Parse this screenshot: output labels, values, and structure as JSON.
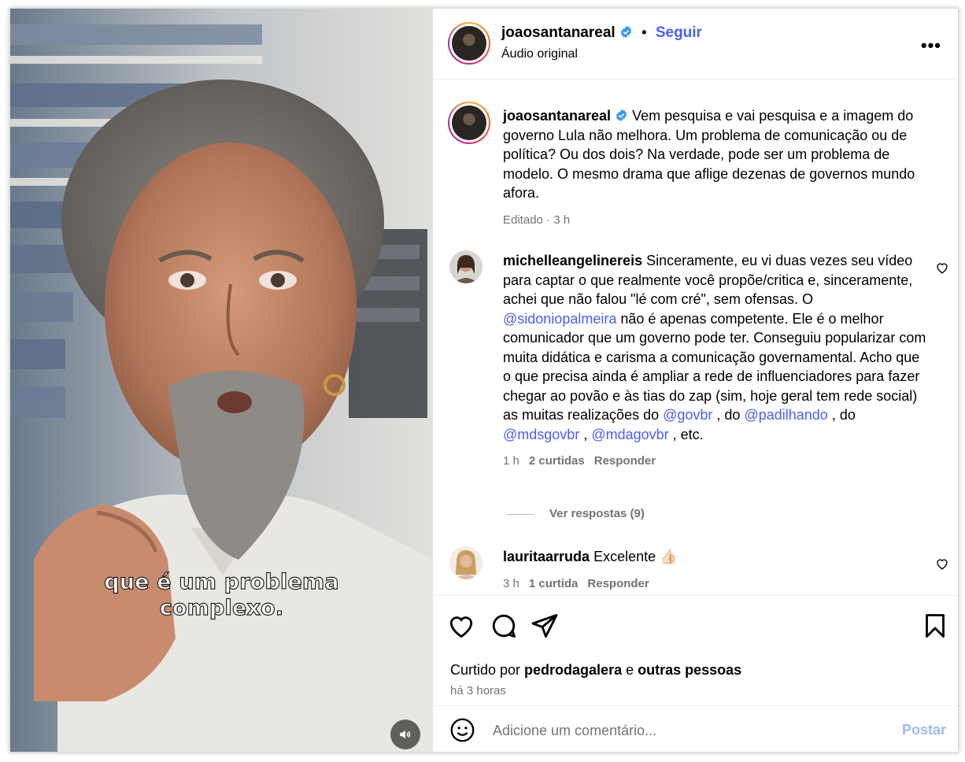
{
  "video": {
    "caption_line1": "que é um problema",
    "caption_line2": "complexo.",
    "mute_icon": "speaker-icon"
  },
  "header": {
    "username": "joaosantanareal",
    "separator": "•",
    "follow_label": "Seguir",
    "subtitle": "Áudio original",
    "more_icon": "more-horizontal-icon"
  },
  "post": {
    "author": "joaosantanareal",
    "text": "Vem pesquisa e vai pesquisa e a imagem do governo Lula não melhora. Um problema de comunicação ou de política? Ou dos dois? Na verdade, pode ser um problema de modelo. O mesmo drama que aflige dezenas de governos mundo afora.",
    "meta": "Editado · 3 h"
  },
  "comments": [
    {
      "author": "michelleangelinereis",
      "text_1": "Sinceramente, eu vi duas vezes seu vídeo para captar o que realmente você propõe/critica e, sinceramente, achei que não falou \"lé com cré\", sem ofensas. O ",
      "mention_1": "@sidoniopalmeira",
      "text_2": " não é apenas competente. Ele é o melhor comunicador que um governo pode ter. Conseguiu popularizar com muita didática e carisma a comunicação governamental. Acho que o que precisa ainda é ampliar a rede de influenciadores para fazer chegar ao povão e às tias do zap (sim, hoje geral tem rede social) as muitas realizações do ",
      "mention_2": "@govbr",
      "text_3": " , do ",
      "mention_3": "@padilhando",
      "text_4": " , do ",
      "mention_4": "@mdsgovbr",
      "text_5": " , ",
      "mention_5": "@mdagovbr",
      "text_6": " , etc.",
      "time": "1 h",
      "likes": "2 curtidas",
      "reply": "Responder",
      "view_replies": "Ver respostas (9)"
    },
    {
      "author": "lauritaarruda",
      "text": "Excelente 👍🏻",
      "time": "3 h",
      "likes": "1 curtida",
      "reply": "Responder"
    }
  ],
  "actions": {
    "liked_by_prefix": "Curtido por ",
    "liked_by_user": "pedrodagalera",
    "liked_by_mid": " e ",
    "liked_by_rest": "outras pessoas",
    "time_ago": "há 3 horas"
  },
  "compose": {
    "placeholder": "Adicione um comentário...",
    "post_label": "Postar"
  },
  "colors": {
    "link": "#4a5df9",
    "muted": "#737373",
    "post_disabled": "#a0b9f6"
  }
}
